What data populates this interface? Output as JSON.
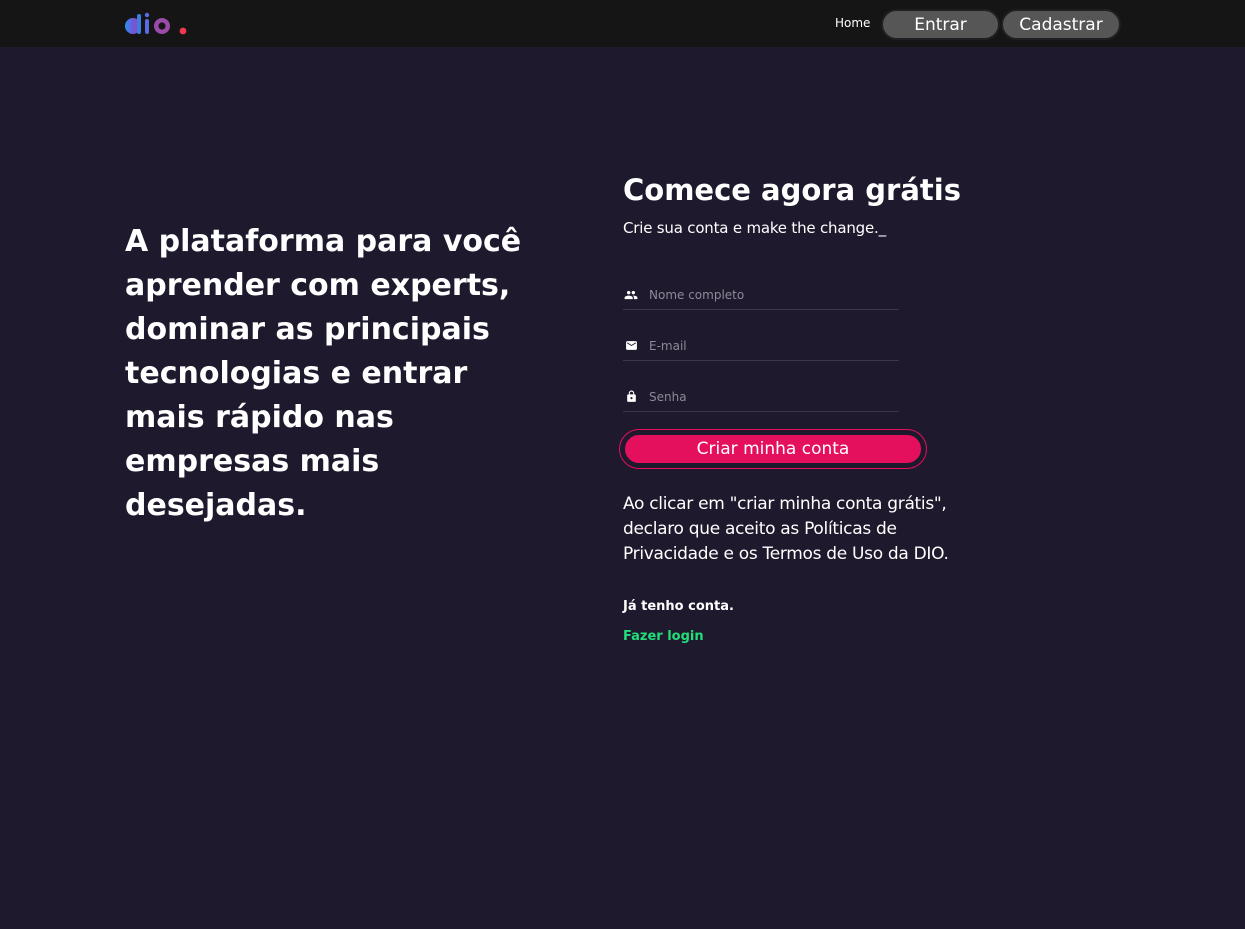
{
  "header": {
    "logo_alt": "dio.",
    "nav_home": "Home",
    "btn_entrar": "Entrar",
    "btn_cadastrar": "Cadastrar"
  },
  "hero": {
    "headline": "A plataforma para você aprender com experts, dominar as principais tecnologias e entrar mais rápido nas empresas mais desejadas."
  },
  "form": {
    "title": "Comece agora grátis",
    "subtitle": "Crie sua conta e make the change._",
    "fields": {
      "name": {
        "placeholder": "Nome completo",
        "value": "",
        "icon": "people-icon"
      },
      "email": {
        "placeholder": "E-mail",
        "value": "",
        "icon": "mail-icon"
      },
      "password": {
        "placeholder": "Senha",
        "value": "",
        "icon": "lock-icon"
      }
    },
    "submit_label": "Criar minha conta",
    "terms": "Ao clicar em \"criar minha conta grátis\", declaro que aceito as Políticas de Privacidade e os Termos de Uso da DIO.",
    "have_account": "Já tenho conta.",
    "login_link": "Fazer login"
  },
  "colors": {
    "background": "#1e192c",
    "header": "#151515",
    "accent": "#e4105d",
    "link": "#23dd7a",
    "nav_button": "#565656"
  }
}
